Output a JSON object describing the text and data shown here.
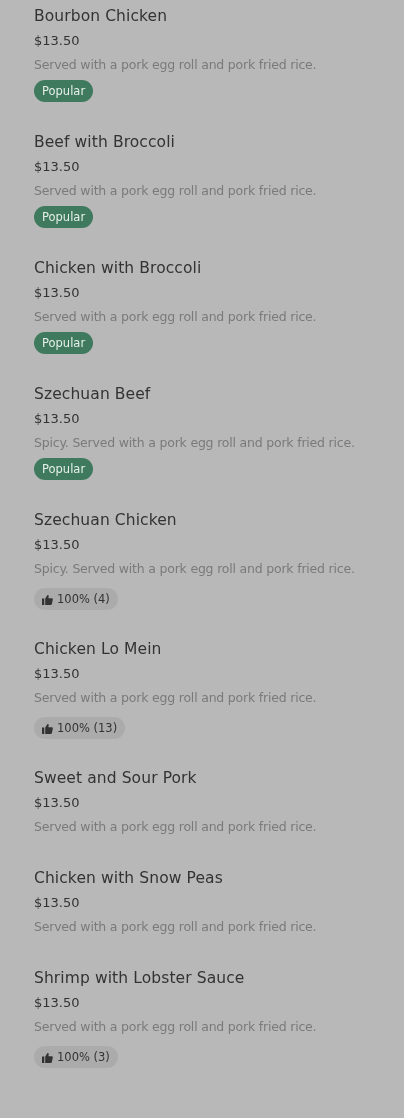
{
  "menu_items": [
    {
      "name": "Bourbon Chicken",
      "price": "$13.50",
      "description": "Served with a pork egg roll and pork fried rice.",
      "badge": {
        "kind": "popular",
        "text": "Popular"
      }
    },
    {
      "name": "Beef with Broccoli",
      "price": "$13.50",
      "description": "Served with a pork egg roll and pork fried rice.",
      "badge": {
        "kind": "popular",
        "text": "Popular"
      }
    },
    {
      "name": "Chicken with Broccoli",
      "price": "$13.50",
      "description": "Served with a pork egg roll and pork fried rice.",
      "badge": {
        "kind": "popular",
        "text": "Popular"
      }
    },
    {
      "name": "Szechuan Beef",
      "price": "$13.50",
      "description": "Spicy. Served with a pork egg roll and pork fried rice.",
      "badge": {
        "kind": "popular",
        "text": "Popular"
      }
    },
    {
      "name": "Szechuan Chicken",
      "price": "$13.50",
      "description": "Spicy. Served with a pork egg roll and pork fried rice.",
      "badge": {
        "kind": "rating",
        "text": "100% (4)"
      }
    },
    {
      "name": "Chicken Lo Mein",
      "price": "$13.50",
      "description": "Served with a pork egg roll and pork fried rice.",
      "badge": {
        "kind": "rating",
        "text": "100% (13)"
      }
    },
    {
      "name": "Sweet and Sour Pork",
      "price": "$13.50",
      "description": "Served with a pork egg roll and pork fried rice."
    },
    {
      "name": "Chicken with Snow Peas",
      "price": "$13.50",
      "description": "Served with a pork egg roll and pork fried rice."
    },
    {
      "name": "Shrimp with Lobster Sauce",
      "price": "$13.50",
      "description": "Served with a pork egg roll and pork fried rice.",
      "badge": {
        "kind": "rating",
        "text": "100% (3)"
      }
    }
  ]
}
